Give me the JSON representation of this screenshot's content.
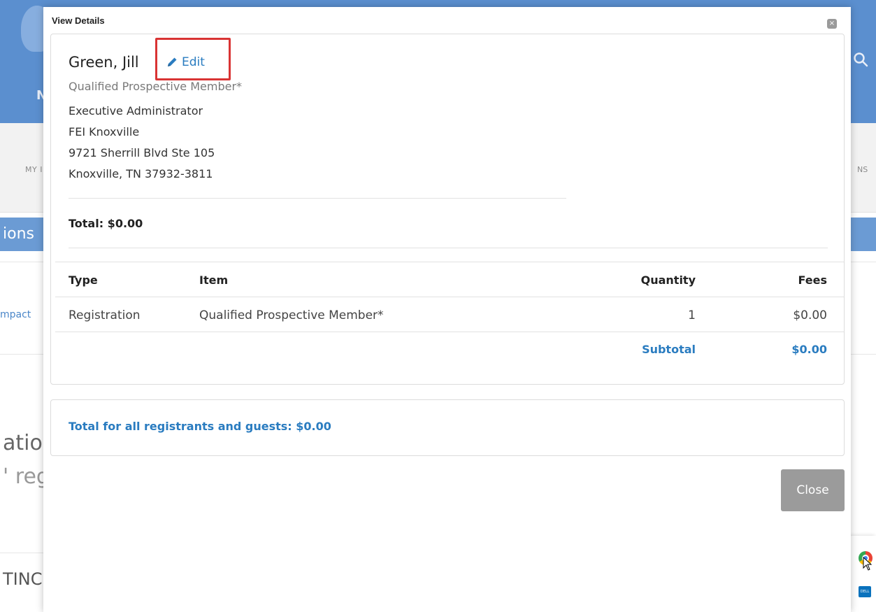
{
  "background": {
    "logo_letter": "N",
    "nav_left_text": "MY I",
    "nav_right_text": "NS",
    "band_text": "ions",
    "compact_text": "mpact",
    "large_text_1": "atio",
    "large_text_2": "' reg",
    "large_text_3": "TINC"
  },
  "modal": {
    "title": "View Details",
    "close_icon_glyph": "×",
    "registrant": {
      "name": "Green, Jill",
      "edit_label": "Edit",
      "member_type": "Qualified Prospective Member*",
      "address_lines": [
        "Executive Administrator",
        "FEI Knoxville",
        "9721 Sherrill Blvd Ste 105",
        "Knoxville, TN 37932-3811"
      ],
      "total": "Total: $0.00"
    },
    "table": {
      "headers": [
        "Type",
        "Item",
        "Quantity",
        "Fees"
      ],
      "rows": [
        [
          "Registration",
          "Qualified Prospective Member*",
          "1",
          "$0.00"
        ]
      ],
      "subtotal_label": "Subtotal",
      "subtotal_value": "$0.00"
    },
    "grand_total": "Total for all registrants and guests: $0.00",
    "close_button": "Close"
  },
  "taskbar": {
    "dell_label": "DELL"
  },
  "colors": {
    "header_blue": "#5b8fcf",
    "link_blue": "#2a7cc0",
    "highlight_red": "#d93434",
    "button_gray": "#9b9b9b"
  }
}
